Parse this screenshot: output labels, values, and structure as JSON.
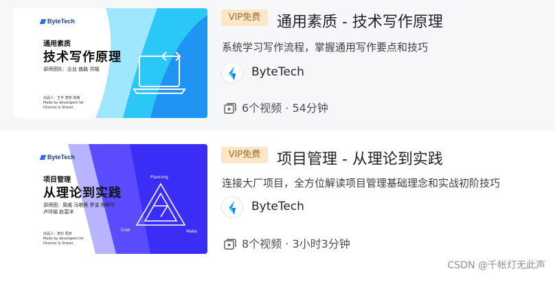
{
  "courses": [
    {
      "badge": "VIP免费",
      "title": "通用素质 - 技术写作原理",
      "description": "系统学习写作流程，掌握通用写作要点和技巧",
      "author": "ByteTech",
      "meta": "6个视频 · 54分钟",
      "thumbnail": {
        "logo": "ByteTech",
        "category": "通用素质",
        "title": "技术写作原理",
        "tags": "讲师团队：企业 曲路 洪福",
        "footer_1": "出品人：王丰 唐宛 易瑞",
        "footer_2": "Made by developers for",
        "footer_3": "Director & Sharer",
        "code_icon": "code-brackets-icon",
        "colors": [
          "#9fe6ff",
          "#2bc7f7",
          "#1f8ef2"
        ]
      }
    },
    {
      "badge": "VIP免费",
      "title": "项目管理 - 从理论到实践",
      "description": "连接大厂项目，全方位解读项目管理基础理念和实战初阶技巧",
      "author": "ByteTech",
      "meta": "8个视频 · 3小时3分钟",
      "thumbnail": {
        "logo": "ByteTech",
        "category": "项目管理",
        "title": "从理论到实践",
        "tags_1": "讲师团：周威 马艳茜 罗浚 杨桦平",
        "tags_2": "卢玲娟 赵富洋",
        "footer_1": "出品人：李红 周双",
        "footer_2": "Made by developers for",
        "footer_3": "Director & Sharer",
        "label_planning": "Planning",
        "label_cost": "Cost",
        "label_make": "Make",
        "colors": [
          "#b9b4ff",
          "#5a4bff",
          "#3a2df5"
        ]
      }
    }
  ],
  "watermark": "CSDN @千帐灯无此声",
  "accent": "#1f8ef2"
}
